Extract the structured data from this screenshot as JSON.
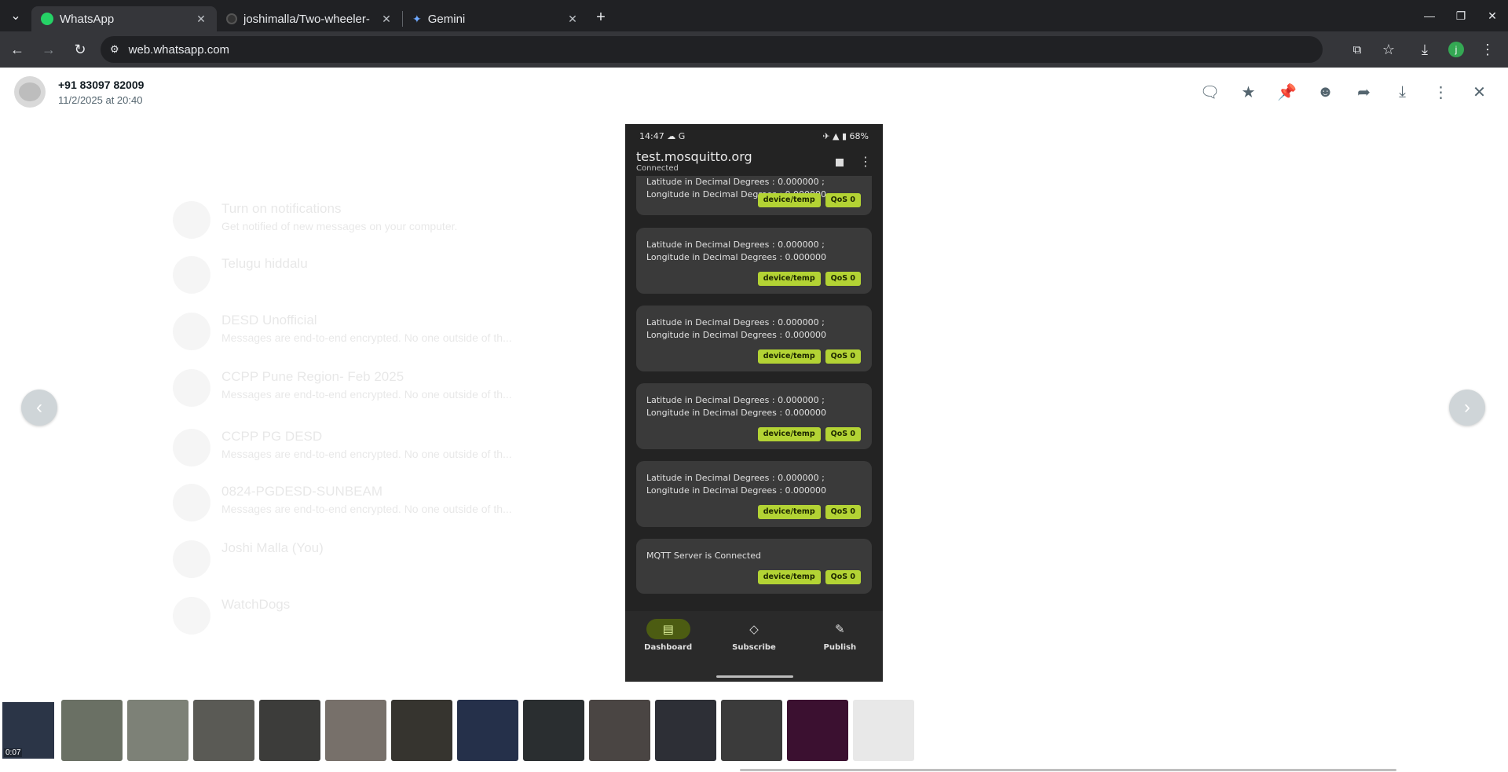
{
  "browser": {
    "tabs": [
      {
        "title": "WhatsApp",
        "icon": "whatsapp-icon",
        "active": true
      },
      {
        "title": "joshimalla/Two-wheeler-",
        "icon": "github-icon",
        "active": false
      },
      {
        "title": "Gemini",
        "icon": "gemini-icon",
        "active": false
      }
    ],
    "url": "web.whatsapp.com",
    "profile_initial": "j"
  },
  "viewer": {
    "contact_name": "+91 83097 82009",
    "date": "11/2/2025 at 20:40",
    "actions": [
      "reply-icon",
      "star-icon",
      "pin-icon",
      "emoji-icon",
      "forward-icon",
      "download-icon",
      "menu-icon",
      "close-icon"
    ]
  },
  "phone": {
    "time": "14:47",
    "status_icons": "☁ G",
    "battery": "68%",
    "app_title": "test.mosquitto.org",
    "app_status": "Connected",
    "messages": [
      {
        "text": "Latitude in Decimal Degrees : 0.000000 ; Longitude in Decimal Degrees : 0.000000",
        "topic": "device/temp",
        "qos": "QoS 0"
      },
      {
        "text": "Latitude in Decimal Degrees : 0.000000 ; Longitude in Decimal Degrees : 0.000000",
        "topic": "device/temp",
        "qos": "QoS 0"
      },
      {
        "text": "Latitude in Decimal Degrees : 0.000000 ; Longitude in Decimal Degrees : 0.000000",
        "topic": "device/temp",
        "qos": "QoS 0"
      },
      {
        "text": "Latitude in Decimal Degrees : 0.000000 ; Longitude in Decimal Degrees : 0.000000",
        "topic": "device/temp",
        "qos": "QoS 0"
      },
      {
        "text": "Latitude in Decimal Degrees : 0.000000 ; Longitude in Decimal Degrees : 0.000000",
        "topic": "device/temp",
        "qos": "QoS 0"
      },
      {
        "text": "MQTT Server is Connected",
        "topic": "device/temp",
        "qos": "QoS 0"
      }
    ],
    "nav": [
      {
        "label": "Dashboard",
        "icon": "dashboard-icon"
      },
      {
        "label": "Subscribe",
        "icon": "tag-icon"
      },
      {
        "label": "Publish",
        "icon": "publish-icon"
      }
    ]
  },
  "background_chats": [
    {
      "name": "Turn on notifications",
      "msg": "Get notified of new messages on your computer."
    },
    {
      "name": "Telugu hiddalu",
      "msg": ""
    },
    {
      "name": "DESD Unofficial",
      "msg": "Messages are end-to-end encrypted. No one outside of th..."
    },
    {
      "name": "CCPP Pune Region- Feb 2025",
      "msg": "Messages are end-to-end encrypted. No one outside of th..."
    },
    {
      "name": "CCPP PG DESD",
      "msg": "Messages are end-to-end encrypted. No one outside of th..."
    },
    {
      "name": "0824-PGDESD-SUNBEAM",
      "msg": "Messages are end-to-end encrypted. No one outside of th..."
    },
    {
      "name": "Joshi Malla (You)",
      "msg": ""
    },
    {
      "name": "WatchDogs",
      "msg": ""
    }
  ],
  "thumbnails": {
    "first_duration": "0:07",
    "colors": [
      "#2b3547",
      "#6a7064",
      "#7d8177",
      "#5a5a55",
      "#3c3c3a",
      "#77706a",
      "#36342f",
      "#25304a",
      "#2a2e30",
      "#4a4543",
      "#2d2f36",
      "#3b3b3b",
      "#3b1030",
      "#e8e8e8"
    ]
  }
}
